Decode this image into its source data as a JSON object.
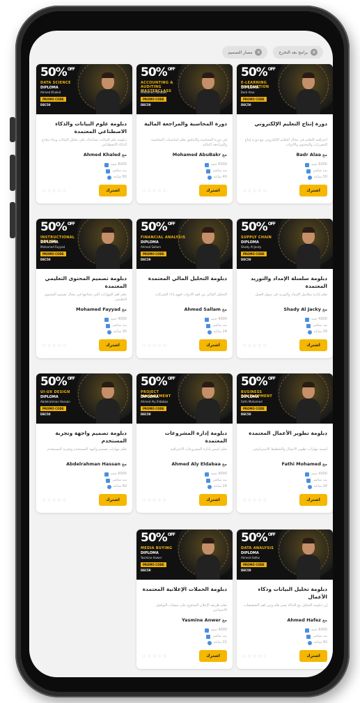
{
  "filters": [
    {
      "label": "برامج بعد التخرج"
    },
    {
      "label": "مسار التصميم"
    }
  ],
  "enroll_label": "اشترك",
  "with_label": "مع",
  "stars": "☆☆☆☆☆",
  "courses": [
    {
      "off": "50%",
      "off_sub": "OFF",
      "category": "E-LEARNING PRODUCTION",
      "diploma": "DIPLOMA",
      "instructor_en": "Badr Alaa",
      "promo": "PROMO CODE",
      "code": "DEC50",
      "title": "دورة إنتاج التعليم الإلكتروني",
      "desc": "احترافية التعليم في مجال التعليم الإلكتروني مع دورة إنتاج المقررات والمحتوى والأدوات",
      "instructor": "Badr Alaa",
      "price": "6000 جنيه",
      "mode": "بث مباشر",
      "hours": "50 ساعة"
    },
    {
      "off": "50%",
      "off_sub": "OFF",
      "category": "ACCOUNTING & AUDITING MASTERCLASS",
      "diploma": "",
      "instructor_en": "Mohamed AbuBakr",
      "promo": "PROMO CODE",
      "code": "DEC50",
      "title": "دورة المحاسبة والمراجعة المالية",
      "desc": "في دورة المحاسبة والتدقيق تعلم أساسيات المحاسبة والمراجعة المالية",
      "instructor": "Mohamed AbuBakr",
      "price": "6000 جنيه",
      "mode": "بث مباشر",
      "hours": "40 ساعة"
    },
    {
      "off": "50%",
      "off_sub": "OFF",
      "category": "DATA SCIENCE",
      "diploma": "DIPLOMA",
      "instructor_en": "Ahmed Khaled",
      "promo": "PROMO CODE",
      "code": "DEC50",
      "title": "دبلومة علوم البيانات والذكاء الاصطناعي المعتمدة",
      "desc": "دبلومة علم البيانات تساعدك على تحليل البيانات وبناء نماذج الذكاء الاصطناعي",
      "instructor": "Ahmed Khaled",
      "price": "8000 جنيه",
      "mode": "بث مباشر",
      "hours": "60 ساعة"
    },
    {
      "off": "50%",
      "off_sub": "OFF",
      "category": "SUPPLY CHAIN",
      "diploma": "DIPLOMA",
      "instructor_en": "Shady Al Jacky",
      "promo": "PROMO CODE",
      "code": "DEC50",
      "title": "دبلومة سلسلة الإمداد والتوريد المعتمدة",
      "desc": "تعلم إدارة سلاسل الإمداد والتوريد في سوق العمل",
      "instructor": "Shady Al Jacky",
      "price": "4000 جنيه",
      "mode": "بث مباشر",
      "hours": "24 ساعة"
    },
    {
      "off": "50%",
      "off_sub": "OFF",
      "category": "FINANCIAL ANALYSIS",
      "diploma": "DIPLOMA",
      "instructor_en": "Ahmed Sallam",
      "promo": "PROMO CODE",
      "code": "DEC50",
      "title": "دبلومة التحليل المالي المعتمدة",
      "desc": "التحليل المالي من أهم الأدوات لفهم أداء الشركات",
      "instructor": "Ahmed Sallam",
      "price": "4000 جنيه",
      "mode": "بث مباشر",
      "hours": "24 ساعة"
    },
    {
      "off": "50%",
      "off_sub": "OFF",
      "category": "INSTRUCTIONAL DESIGN",
      "diploma": "DIPLOMA",
      "instructor_en": "Mohamed Fayyad",
      "promo": "PROMO CODE",
      "code": "DEC50",
      "title": "دبلومة تصميم المحتوى التعليمي المعتمدة",
      "desc": "تعلم أهم المهارات التي تحتاجها في مجال تصميم المحتوى التعليمي",
      "instructor": "Mohamed Fayyad",
      "price": "4000 جنيه",
      "mode": "بث مباشر",
      "hours": "30 ساعة"
    },
    {
      "off": "50%",
      "off_sub": "OFF",
      "category": "BUSINESS DEVELOPMENT",
      "diploma": "DIPLOMA",
      "instructor_en": "Fathi Mohamed",
      "promo": "PROMO CODE",
      "code": "DEC50",
      "title": "دبلومة تطوير الأعمال المعتمدة",
      "desc": "لتنمية مهارات تطوير الأعمال والتخطيط الاستراتيجي",
      "instructor": "Fathi Mohamed",
      "price": "4000 جنيه",
      "mode": "بث مباشر",
      "hours": "24 ساعة"
    },
    {
      "off": "50%",
      "off_sub": "OFF",
      "category": "PROJECT MANAGEMENT",
      "diploma": "DIPLOMA",
      "instructor_en": "Ahmed Aly Eldabaa",
      "promo": "PROMO CODE",
      "code": "DEC50",
      "title": "دبلومة إدارة المشروعات المعتمدة",
      "desc": "تعلم أسس إدارة المشروعات الاحترافية",
      "instructor": "Ahmed Aly Eldabaa",
      "price": "4000 جنيه",
      "mode": "بث مباشر",
      "hours": "24 ساعة"
    },
    {
      "off": "50%",
      "off_sub": "OFF",
      "category": "UI-UX DESIGN",
      "diploma": "DIPLOMA",
      "instructor_en": "Abdelrahman Hassan",
      "promo": "PROMO CODE",
      "code": "DEC50",
      "title": "دبلومة تصميم واجهة وتجربة المستخدم",
      "desc": "تعلم مهارات تصميم واجهة المستخدم وتجربة المستخدم",
      "instructor": "Abdelrahman Hassan",
      "price": "6000 جنيه",
      "mode": "بث مباشر",
      "hours": "40 ساعة"
    },
    {
      "off": "50%",
      "off_sub": "OFF",
      "category": "DATA ANALYSIS",
      "diploma": "DIPLOMA",
      "instructor_en": "Ahmed Hafez",
      "promo": "PROMO CODE",
      "code": "DEC50",
      "title": "دبلومة تحليل البيانات وذكاء الأعمال",
      "desc": "إن دبلومة التحليل مع الذكاء يعتبر هام ومن أهم التخصصات",
      "instructor": "Ahmed Hafez",
      "price": "6000 جنيه",
      "mode": "بث مباشر",
      "hours": "40 ساعة"
    },
    {
      "off": "50%",
      "off_sub": "OFF",
      "category": "MEDIA BUYING",
      "diploma": "DIPLOMA",
      "instructor_en": "Yasmine Anwer",
      "promo": "PROMO CODE",
      "code": "DEC50",
      "title": "دبلومة الحملات الإعلانية المعتمدة",
      "desc": "تعلم طريقة الإعلان المدفوع على منصات التواصل الاجتماعي",
      "instructor": "Yasmine Anwer",
      "price": "4000 جنيه",
      "mode": "بث مباشر",
      "hours": "21 ساعة"
    }
  ]
}
